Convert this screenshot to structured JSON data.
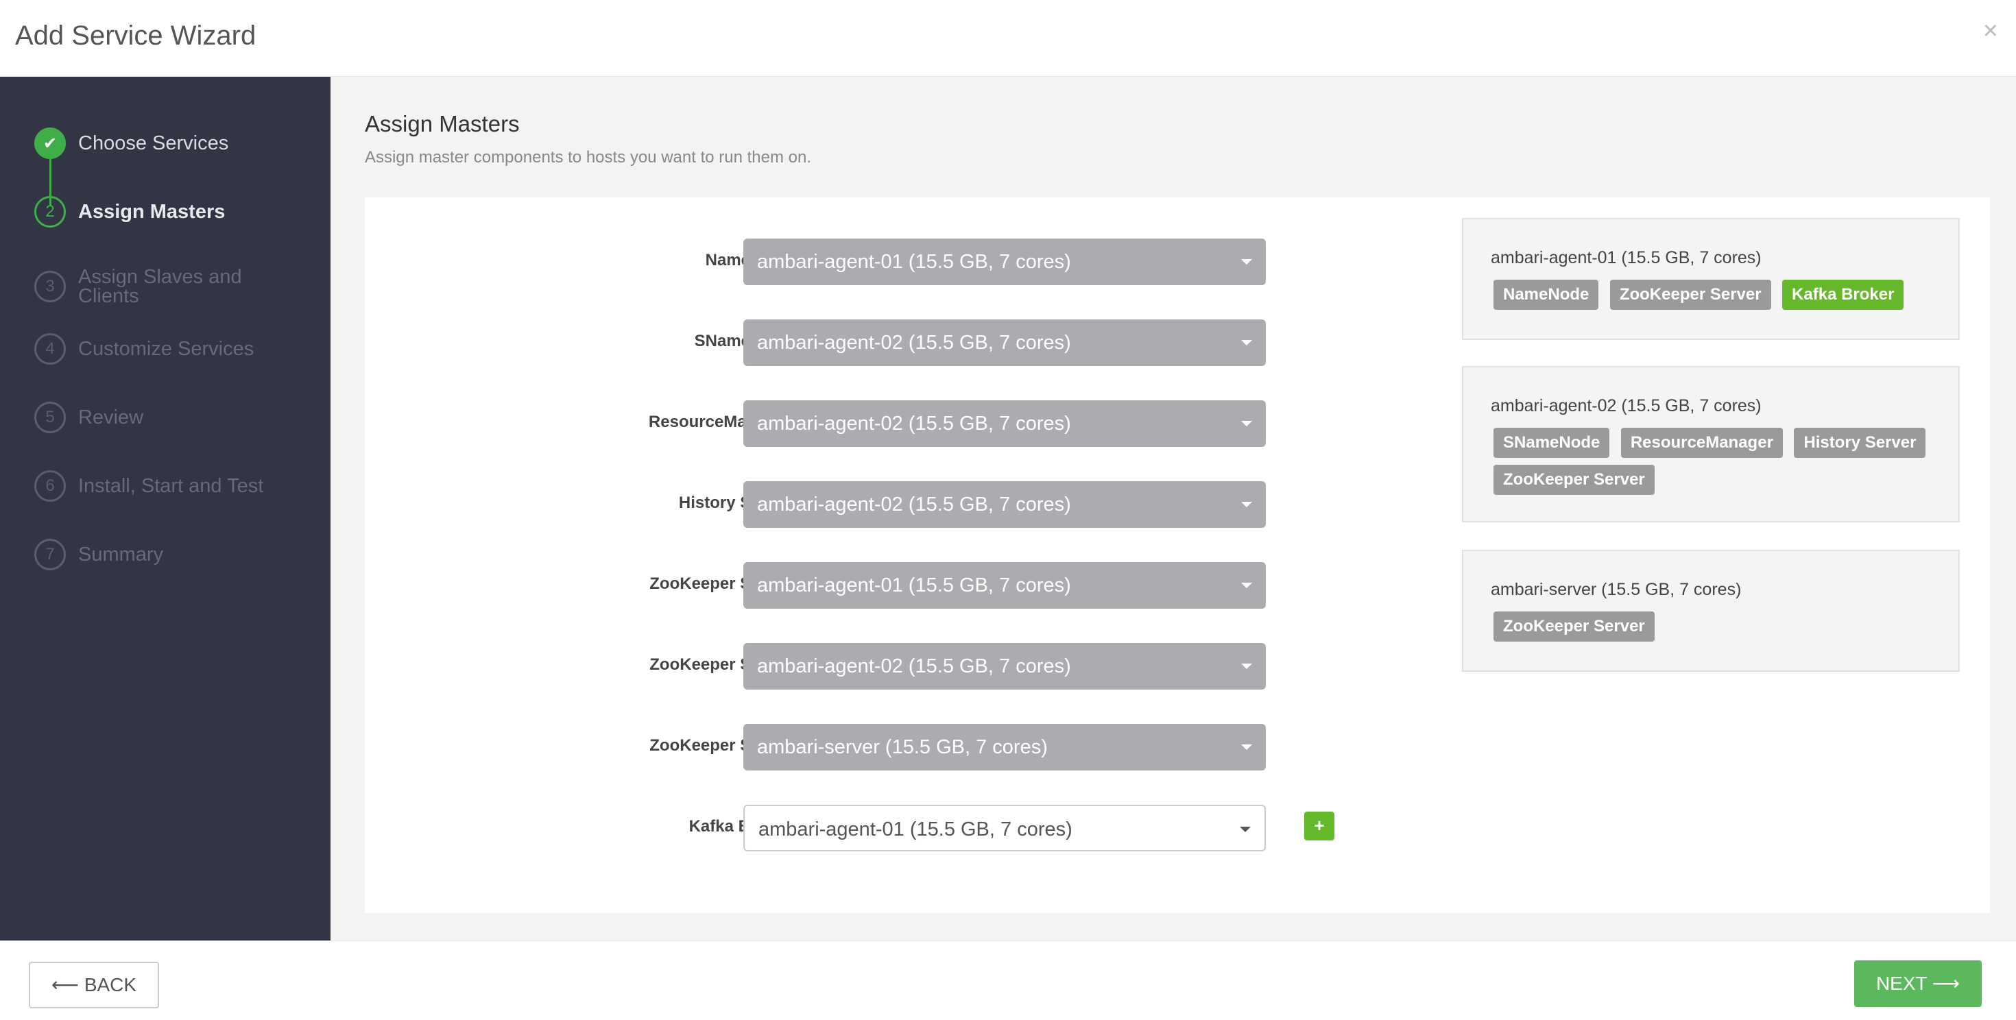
{
  "header": {
    "title": "Add Service Wizard",
    "close_icon": "×"
  },
  "sidebar": {
    "steps": [
      {
        "number": "✔",
        "label": "Choose Services",
        "state": "done"
      },
      {
        "number": "2",
        "label": "Assign Masters",
        "state": "current"
      },
      {
        "number": "3",
        "label": "Assign Slaves and Clients",
        "state": "upcoming"
      },
      {
        "number": "4",
        "label": "Customize Services",
        "state": "upcoming"
      },
      {
        "number": "5",
        "label": "Review",
        "state": "upcoming"
      },
      {
        "number": "6",
        "label": "Install, Start and Test",
        "state": "upcoming"
      },
      {
        "number": "7",
        "label": "Summary",
        "state": "upcoming"
      }
    ]
  },
  "main": {
    "title": "Assign Masters",
    "subtitle": "Assign master components to hosts you want to run them on.",
    "assignments": [
      {
        "label": "NameNode:",
        "value": "ambari-agent-01 (15.5 GB, 7 cores)"
      },
      {
        "label": "SNameNode:",
        "value": "ambari-agent-02 (15.5 GB, 7 cores)"
      },
      {
        "label": "ResourceManager:",
        "value": "ambari-agent-02 (15.5 GB, 7 cores)"
      },
      {
        "label": "History Server:",
        "value": "ambari-agent-02 (15.5 GB, 7 cores)"
      },
      {
        "label": "ZooKeeper Server:",
        "value": "ambari-agent-01 (15.5 GB, 7 cores)"
      },
      {
        "label": "ZooKeeper Server:",
        "value": "ambari-agent-02 (15.5 GB, 7 cores)"
      },
      {
        "label": "ZooKeeper Server:",
        "value": "ambari-server (15.5 GB, 7 cores)"
      },
      {
        "label": "Kafka Broker:",
        "value": "ambari-agent-01 (15.5 GB, 7 cores)"
      }
    ],
    "add_button": "+",
    "hosts": [
      {
        "name": "ambari-agent-01 (15.5 GB, 7 cores)",
        "components": [
          "NameNode",
          "ZooKeeper Server",
          "Kafka Broker"
        ]
      },
      {
        "name": "ambari-agent-02 (15.5 GB, 7 cores)",
        "components": [
          "SNameNode",
          "ResourceManager",
          "History Server",
          "ZooKeeper Server"
        ]
      },
      {
        "name": "ambari-server (15.5 GB, 7 cores)",
        "components": [
          "ZooKeeper Server"
        ]
      }
    ]
  },
  "footer": {
    "back_label": "⟵ BACK",
    "next_label": "NEXT ⟶"
  },
  "colors": {
    "accent": "#3fae49",
    "sidebar": "#323544",
    "new_tag": "#66b82b"
  }
}
